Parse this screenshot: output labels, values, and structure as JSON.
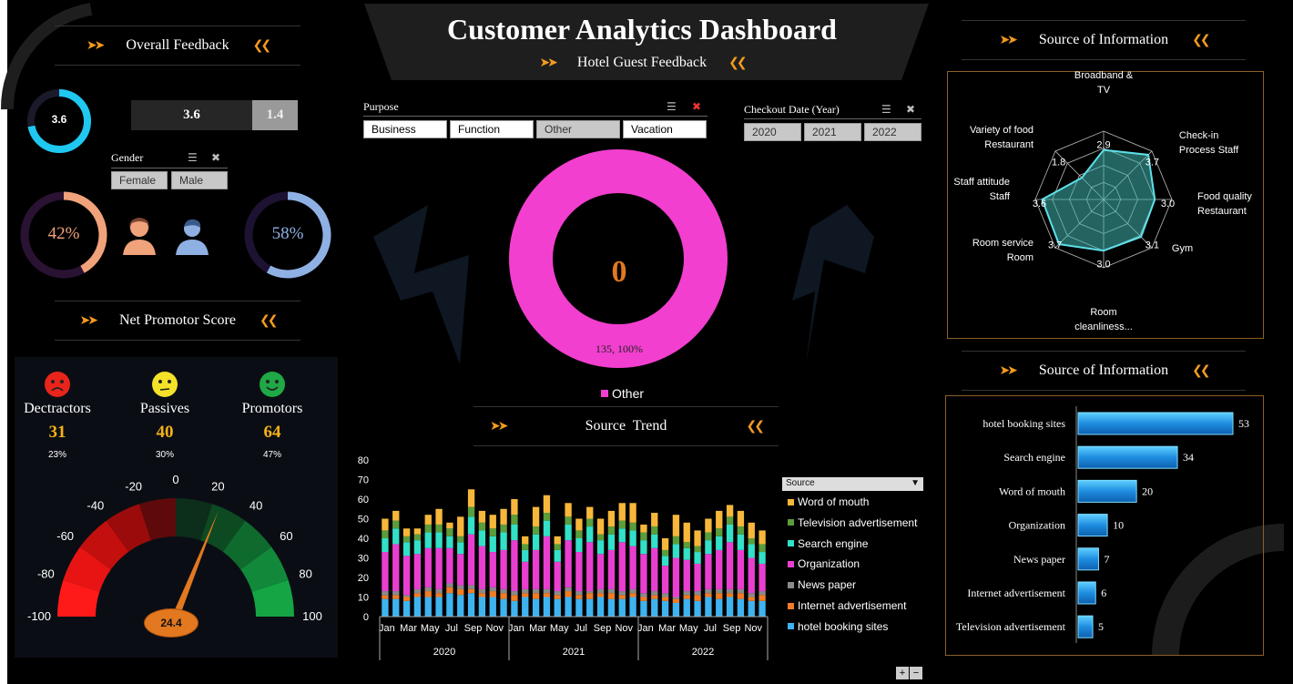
{
  "title": "Customer Analytics Dashboard",
  "subtitle": "Hotel Guest Feedback",
  "overall": {
    "header": "Overall Feedback",
    "ring_value": "3.6",
    "bar_left": "3.6",
    "bar_right": "1.4",
    "gender_title": "Gender",
    "gender_options": [
      "Female",
      "Male"
    ],
    "female_pct": "42%",
    "male_pct": "58%",
    "female_fraction": 0.42,
    "male_fraction": 0.58,
    "ring_fraction": 0.72
  },
  "nps": {
    "header": "Net Promotor Score",
    "groups": [
      {
        "label": "Dectractors",
        "count": "31",
        "pct": "23%",
        "color": "#e8241b"
      },
      {
        "label": "Passives",
        "count": "40",
        "pct": "30%",
        "color": "#f3e12a"
      },
      {
        "label": "Promotors",
        "count": "64",
        "pct": "47%",
        "color": "#1fa845"
      }
    ],
    "gauge_value": "24.4",
    "gauge_number": 24.4,
    "gauge_ticks": [
      "-100",
      "-80",
      "-60",
      "-40",
      "-20",
      "0",
      "20",
      "40",
      "60",
      "80",
      "100"
    ]
  },
  "purpose": {
    "title": "Purpose",
    "options": [
      "Business",
      "Function",
      "Other",
      "Vacation"
    ],
    "selected": [
      true,
      true,
      false,
      true
    ]
  },
  "checkout": {
    "title": "Checkout Date (Year)",
    "options": [
      "2020",
      "2021",
      "2022"
    ]
  },
  "donut": {
    "center": "0",
    "label": "135, 100%",
    "legend": "Other",
    "color": "#f23fcf"
  },
  "trend": {
    "header": "Source  Trend",
    "legend_title": "Source",
    "legend": [
      {
        "name": "Word of mouth",
        "color": "#f7b73a"
      },
      {
        "name": "Television advertisement",
        "color": "#5a9e3c"
      },
      {
        "name": "Search engine",
        "color": "#33e0c8"
      },
      {
        "name": "Organization",
        "color": "#e93fd0"
      },
      {
        "name": "News paper",
        "color": "#8a8a8a"
      },
      {
        "name": "Internet advertisement",
        "color": "#f07c25"
      },
      {
        "name": "hotel booking sites",
        "color": "#3fb3f0"
      }
    ],
    "y_ticks": [
      "80",
      "70",
      "60",
      "50",
      "40",
      "30",
      "20",
      "10",
      "0"
    ],
    "month_labels": [
      "Jan",
      "Mar",
      "May",
      "Jul",
      "Sep",
      "Nov"
    ],
    "years": [
      "2020",
      "2021",
      "2022"
    ]
  },
  "chart_data": [
    {
      "type": "bar",
      "title": "Source  Trend",
      "stacked": true,
      "ylim": [
        0,
        80
      ],
      "categories": [
        "Jan 2020",
        "Feb 2020",
        "Mar 2020",
        "Apr 2020",
        "May 2020",
        "Jun 2020",
        "Jul 2020",
        "Aug 2020",
        "Sep 2020",
        "Oct 2020",
        "Nov 2020",
        "Dec 2020",
        "Jan 2021",
        "Feb 2021",
        "Mar 2021",
        "Apr 2021",
        "May 2021",
        "Jun 2021",
        "Jul 2021",
        "Aug 2021",
        "Sep 2021",
        "Oct 2021",
        "Nov 2021",
        "Dec 2021",
        "Jan 2022",
        "Feb 2022",
        "Mar 2022",
        "Apr 2022",
        "May 2022",
        "Jun 2022",
        "Jul 2022",
        "Aug 2022",
        "Sep 2022",
        "Oct 2022",
        "Nov 2022",
        "Dec 2022"
      ],
      "series": [
        {
          "name": "hotel booking sites",
          "values": [
            9,
            9,
            8,
            10,
            10,
            10,
            12,
            11,
            12,
            10,
            10,
            9,
            8,
            10,
            9,
            10,
            9,
            10,
            9,
            9,
            10,
            9,
            9,
            10,
            8,
            9,
            8,
            7,
            9,
            8,
            10,
            9,
            10,
            9,
            8,
            8
          ]
        },
        {
          "name": "Internet advertisement",
          "values": [
            2,
            2,
            2,
            2,
            3,
            2,
            3,
            3,
            2,
            2,
            3,
            3,
            3,
            2,
            3,
            2,
            2,
            3,
            2,
            3,
            2,
            3,
            2,
            2,
            2,
            2,
            2,
            2,
            2,
            3,
            2,
            3,
            2,
            3,
            2,
            3
          ]
        },
        {
          "name": "News paper",
          "values": [
            2,
            2,
            1,
            2,
            2,
            2,
            2,
            2,
            2,
            2,
            2,
            2,
            2,
            2,
            2,
            2,
            2,
            2,
            2,
            1,
            2,
            2,
            2,
            2,
            2,
            2,
            2,
            1,
            2,
            2,
            2,
            2,
            2,
            2,
            2,
            2
          ]
        },
        {
          "name": "Organization",
          "values": [
            20,
            24,
            20,
            18,
            20,
            21,
            18,
            16,
            26,
            22,
            18,
            20,
            26,
            14,
            20,
            27,
            15,
            24,
            20,
            25,
            18,
            20,
            25,
            22,
            20,
            22,
            14,
            20,
            16,
            14,
            18,
            20,
            24,
            20,
            18,
            14
          ]
        },
        {
          "name": "Search engine",
          "values": [
            7,
            8,
            7,
            7,
            8,
            8,
            6,
            6,
            9,
            8,
            8,
            9,
            8,
            6,
            8,
            8,
            6,
            8,
            7,
            8,
            7,
            8,
            7,
            8,
            7,
            7,
            5,
            7,
            6,
            6,
            7,
            7,
            9,
            8,
            7,
            6
          ]
        },
        {
          "name": "Television advertisement",
          "values": [
            4,
            4,
            3,
            3,
            4,
            4,
            4,
            3,
            5,
            4,
            4,
            4,
            5,
            3,
            4,
            4,
            3,
            4,
            4,
            4,
            3,
            4,
            4,
            4,
            4,
            4,
            3,
            4,
            3,
            3,
            4,
            4,
            4,
            4,
            3,
            4
          ]
        },
        {
          "name": "Word of mouth",
          "values": [
            6,
            5,
            4,
            3,
            5,
            8,
            3,
            10,
            9,
            6,
            7,
            8,
            8,
            4,
            10,
            9,
            4,
            7,
            6,
            6,
            8,
            8,
            9,
            10,
            4,
            7,
            6,
            11,
            10,
            8,
            7,
            9,
            6,
            8,
            8,
            7
          ]
        }
      ]
    },
    {
      "type": "bar",
      "title": "Source of Information",
      "orientation": "horizontal",
      "categories": [
        "hotel booking sites",
        "Search engine",
        "Word of mouth",
        "Organization",
        "News paper",
        "Internet advertisement",
        "Television advertisement"
      ],
      "values": [
        53,
        34,
        20,
        10,
        7,
        6,
        5
      ]
    },
    {
      "type": "radar",
      "title": "Source of Information",
      "categories": [
        "Broadband & TV",
        "Check-in Process Staff",
        "Food quality Restaurant",
        "Gym",
        "Room cleanliness...",
        "Room service Room",
        "Staff attitude Staff",
        "Variety of food Restaurant"
      ],
      "values": [
        2.9,
        3.7,
        3.0,
        3.1,
        3.0,
        3.7,
        3.6,
        1.8
      ],
      "value_labels": [
        "2.9",
        "3.7",
        "3.0",
        "3.1",
        "3.0",
        "3.7",
        "3.6",
        "1.8"
      ]
    }
  ],
  "radar": {
    "header": "Source of Information",
    "labels": [
      [
        "Broadband &",
        "TV"
      ],
      [
        "Check-in",
        "Process Staff"
      ],
      [
        "Food quality",
        "Restaurant"
      ],
      [
        "Gym"
      ],
      [
        "Room",
        "cleanliness..."
      ],
      [
        "Room service",
        "Room"
      ],
      [
        "Staff attitude",
        "Staff"
      ],
      [
        "Variety of food",
        "Restaurant"
      ]
    ]
  },
  "hbar": {
    "header": "Source of Information",
    "labels": [
      "hotel booking sites",
      "Search engine",
      "Word of mouth",
      "Organization",
      "News paper",
      "Internet advertisement",
      "Television advertisement"
    ],
    "values": [
      53,
      34,
      20,
      10,
      7,
      6,
      5
    ]
  },
  "zoom": {
    "plus": "+",
    "minus": "−"
  }
}
